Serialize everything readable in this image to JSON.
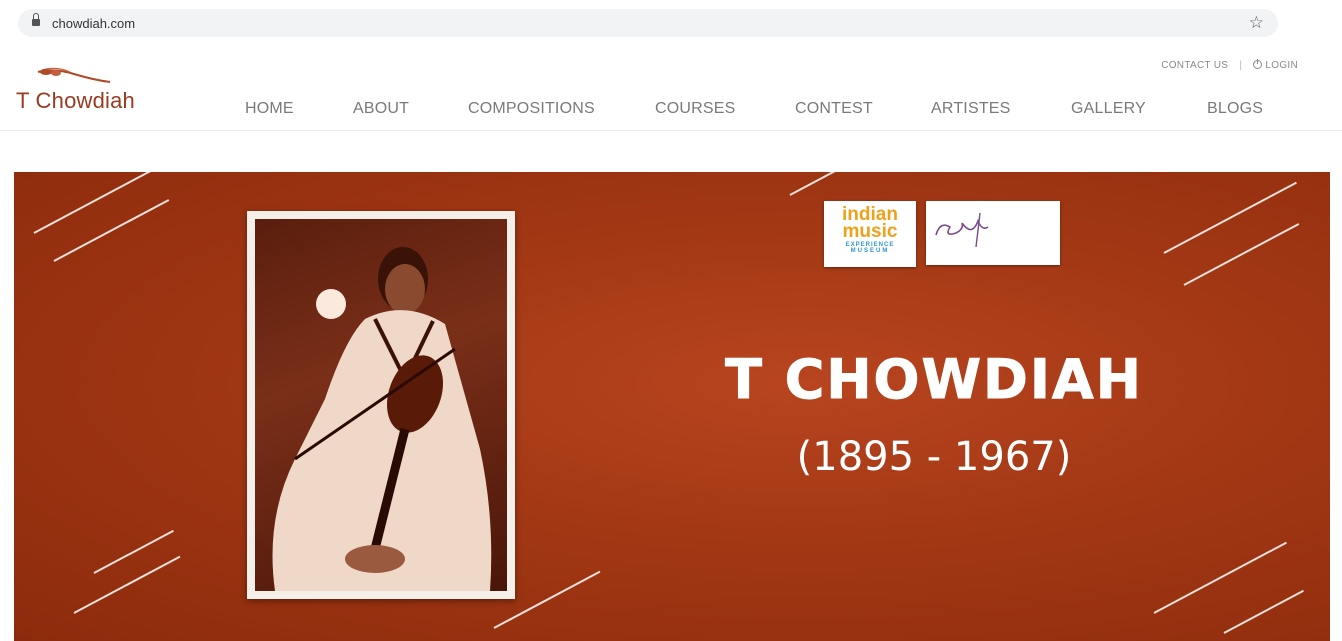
{
  "browser": {
    "url": "chowdiah.com"
  },
  "header": {
    "logo_text": "T Chowdiah",
    "contact_label": "CONTACT US",
    "separator": "|",
    "login_label": "LOGIN",
    "nav": [
      {
        "label": "HOME"
      },
      {
        "label": "ABOUT"
      },
      {
        "label": "COMPOSITIONS"
      },
      {
        "label": "COURSES"
      },
      {
        "label": "CONTEST"
      },
      {
        "label": "ARTISTES"
      },
      {
        "label": "GALLERY"
      },
      {
        "label": "BLOGS"
      }
    ]
  },
  "hero": {
    "title": "T CHOWDIAH",
    "years": "(1895 - 1967)",
    "partner_logo_1": {
      "line1": "indian",
      "line2": "music",
      "line3": "EXPERIENCE",
      "line4": "MUSEUM"
    },
    "colors": {
      "banner": "#a23714",
      "logo_accent": "#9a3a1f"
    }
  }
}
